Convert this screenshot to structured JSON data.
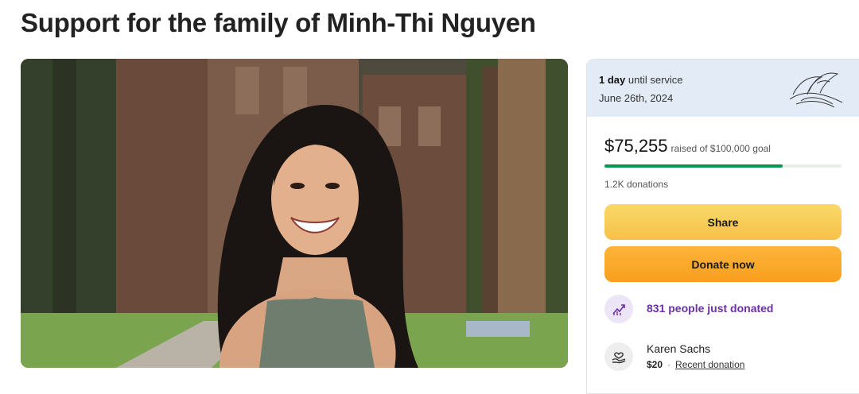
{
  "page": {
    "title": "Support for the family of Minh-Thi Nguyen"
  },
  "hero": {
    "image_icon": "person-photo"
  },
  "card": {
    "service_count": "1 day",
    "service_suffix": "until service",
    "service_date": "June 26th, 2024",
    "raised_amount": "$75,255",
    "raised_goal_text": "raised of $100,000 goal",
    "progress_fraction": 0.75,
    "donations_count": "1.2K donations",
    "share_label": "Share",
    "donate_label": "Donate now",
    "recent_count_text": "831 people just donated",
    "donor_name": "Karen Sachs",
    "donor_amount": "$20",
    "donor_tag": "Recent donation"
  },
  "colors": {
    "progress": "#0d9451",
    "share_button": "#f6c84d",
    "donate_button": "#f9a526",
    "purple_text": "#6b2fa8",
    "header_bg": "#e3ecf6"
  }
}
